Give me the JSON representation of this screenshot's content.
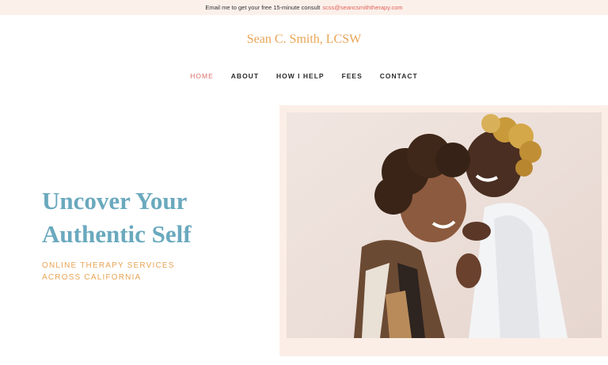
{
  "topbar": {
    "text": "Email me to get your free 15-minute consult",
    "email": "scss@seancsmiththerapy.com"
  },
  "brand": {
    "name": "Sean C. Smith, LCSW"
  },
  "nav": {
    "items": [
      {
        "label": "HOME",
        "active": true
      },
      {
        "label": "ABOUT",
        "active": false
      },
      {
        "label": "HOW I HELP",
        "active": false
      },
      {
        "label": "FEES",
        "active": false
      },
      {
        "label": "CONTACT",
        "active": false
      }
    ]
  },
  "hero": {
    "title_line1": "Uncover Your",
    "title_line2": "Authentic Self",
    "subtitle_line1": "ONLINE THERAPY SERVICES",
    "subtitle_line2": "ACROSS CALIFORNIA"
  },
  "colors": {
    "accent_orange": "#e8a456",
    "accent_teal": "#6aa9be",
    "nav_active": "#d8706a",
    "link_red": "#e0625c",
    "banner_bg": "#fbf0ea"
  }
}
